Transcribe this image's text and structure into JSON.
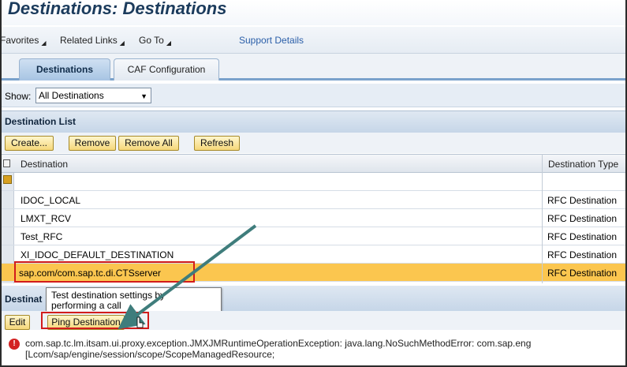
{
  "title": "Destinations: Destinations",
  "menu": {
    "favorites": "Favorites",
    "related_links": "Related Links",
    "go_to": "Go To",
    "support": "Support Details"
  },
  "tabs": [
    {
      "label": "Destinations",
      "active": true
    },
    {
      "label": "CAF Configuration",
      "active": false
    }
  ],
  "filter": {
    "label": "Show:",
    "selected": "All Destinations"
  },
  "destination_list": {
    "title": "Destination List",
    "buttons": {
      "create": "Create...",
      "remove": "Remove",
      "remove_all": "Remove All",
      "refresh": "Refresh"
    },
    "columns": {
      "destination": "Destination",
      "type": "Destination Type"
    },
    "rows": [
      {
        "name": "IDOC_LOCAL",
        "type": "RFC Destination"
      },
      {
        "name": "LMXT_RCV",
        "type": "RFC Destination"
      },
      {
        "name": "Test_RFC",
        "type": "RFC Destination"
      },
      {
        "name": "XI_IDOC_DEFAULT_DESTINATION",
        "type": "RFC Destination"
      },
      {
        "name": "sap.com/com.sap.tc.di.CTSserver",
        "type": "RFC Destination"
      }
    ]
  },
  "details": {
    "title": "Destinat",
    "tooltip_line1": "Test destination settings by",
    "tooltip_line2": "performing a call",
    "edit": "Edit",
    "ping": "Ping Destination"
  },
  "error": {
    "line1": "com.sap.tc.lm.itsam.ui.proxy.exception.JMXJMRuntimeOperationException: java.lang.NoSuchMethodError: com.sap.eng",
    "line2": "[Lcom/sap/engine/session/scope/ScopeManagedResource;"
  },
  "colors": {
    "selected_row": "#fbc64f",
    "highlight": "#d21c1c",
    "annotation_arrow": "#3f7d7c"
  }
}
